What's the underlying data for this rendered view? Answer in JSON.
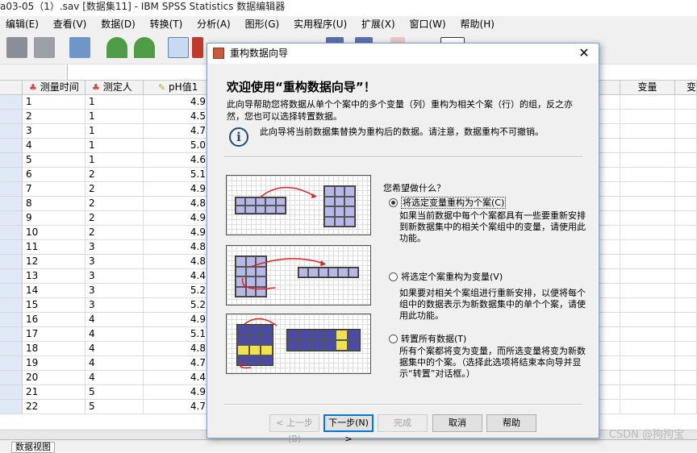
{
  "window": {
    "title": "a03-05（1）.sav [数据集11] - IBM SPSS Statistics 数据编辑器"
  },
  "menu": [
    "编辑(E)",
    "查看(V)",
    "数据(D)",
    "转换(T)",
    "分析(A)",
    "图形(G)",
    "实用程序(U)",
    "扩展(X)",
    "窗口(W)",
    "帮助(H)"
  ],
  "columns": [
    {
      "label": "测量时间",
      "icon": "nominal-variable-icon"
    },
    {
      "label": "测定人",
      "icon": "nominal-variable-icon"
    },
    {
      "label": "pH值1",
      "icon": "scale-variable-icon"
    },
    {
      "label": "变量",
      "icon": ""
    },
    {
      "label": "变",
      "icon": ""
    }
  ],
  "rows": [
    [
      "1",
      "1",
      "4.9"
    ],
    [
      "2",
      "1",
      "4.5"
    ],
    [
      "3",
      "1",
      "4.7"
    ],
    [
      "4",
      "1",
      "5.0"
    ],
    [
      "5",
      "1",
      "4.6"
    ],
    [
      "6",
      "2",
      "5.1"
    ],
    [
      "7",
      "2",
      "4.9"
    ],
    [
      "8",
      "2",
      "4.8"
    ],
    [
      "9",
      "2",
      "4.9"
    ],
    [
      "10",
      "2",
      "4.9"
    ],
    [
      "11",
      "3",
      "4.8"
    ],
    [
      "12",
      "3",
      "4.8"
    ],
    [
      "13",
      "3",
      "4.4"
    ],
    [
      "14",
      "3",
      "5.2"
    ],
    [
      "15",
      "3",
      "5.2"
    ],
    [
      "16",
      "4",
      "4.9"
    ],
    [
      "17",
      "4",
      "5.1"
    ],
    [
      "18",
      "4",
      "4.8"
    ],
    [
      "19",
      "4",
      "4.7"
    ],
    [
      "20",
      "4",
      "4.4"
    ],
    [
      "21",
      "5",
      "4.9"
    ],
    [
      "22",
      "5",
      "4.7"
    ]
  ],
  "dialog": {
    "title": "重构数据向导",
    "close": "✕",
    "heading": "欢迎使用“重构数据向导”！",
    "intro": "此向导帮助您将数据从单个个案中的多个变量（列）重构为相关个案（行）的组，反之亦然，您也可以选择转置数据。",
    "info_icon": "i",
    "info": "此向导将当前数据集替换为重构后的数据。请注意，数据重构不可撤销。",
    "question": "您希望做什么？",
    "options": [
      {
        "label": "将选定变量重构为个案(C)",
        "selected": true,
        "description": "如果当前数据中每个个案都具有一些要重新安排到新数据集中的相关个案组中的变量，请使用此功能。"
      },
      {
        "label": "将选定个案重构为变量(V)",
        "selected": false,
        "description": "如果要对相关个案组进行重新安排，以便将每个组中的数据表示为新数据集中的单个个案，请使用此功能。"
      },
      {
        "label": "转置所有数据(T)",
        "selected": false,
        "description": "所有个案都将变为变量，而所选变量将变为新数据集中的个案。（选择此选项将结束本向导并显示“转置”对话框。）"
      }
    ],
    "buttons": {
      "back": "< 上一步(B)",
      "next": "下一步(N) >",
      "finish": "完成",
      "cancel": "取消",
      "help": "帮助"
    }
  },
  "status": {
    "sheet_tab": "数据视图",
    "watermark": "CSDN @拘拘宝"
  }
}
